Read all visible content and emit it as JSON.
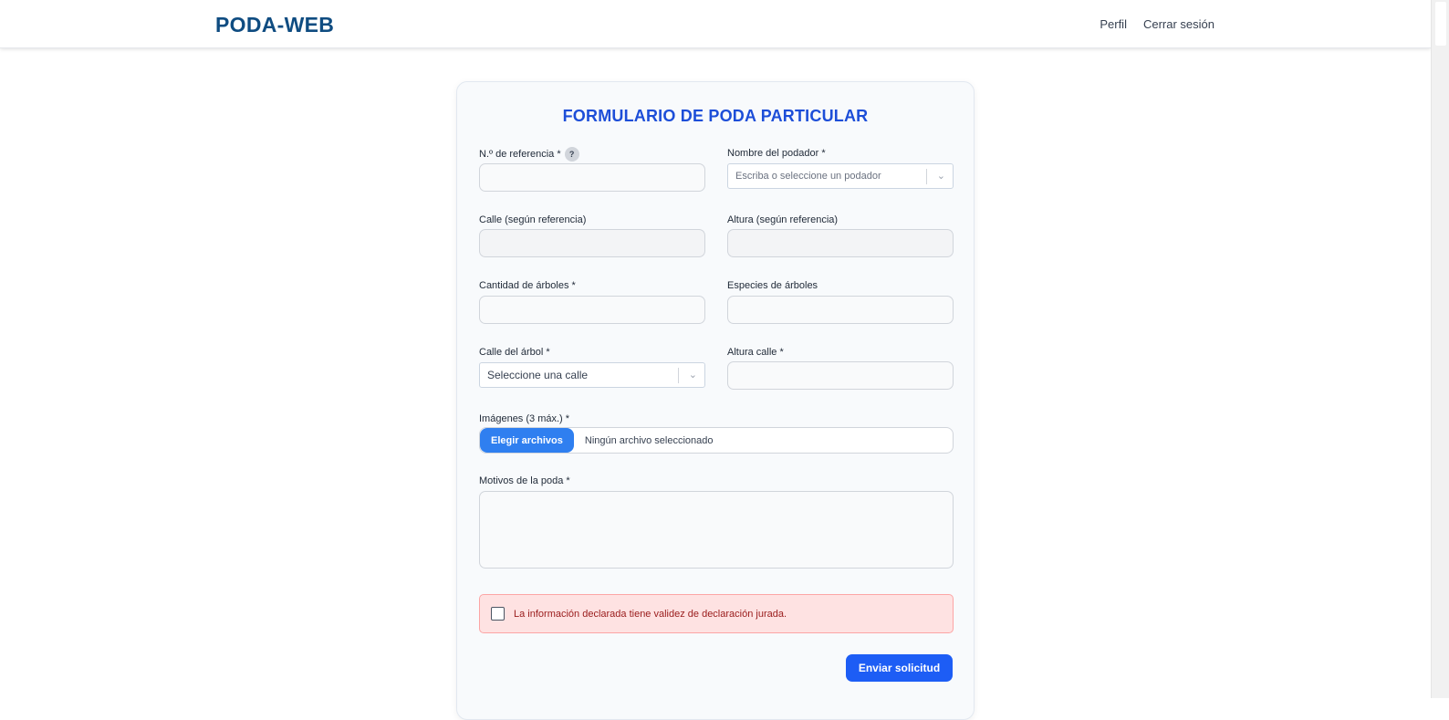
{
  "nav": {
    "brand": "PODA-WEB",
    "links": [
      "Perfil",
      "Cerrar sesión"
    ]
  },
  "form": {
    "title": "FORMULARIO DE PODA PARTICULAR",
    "fields": {
      "referencia": {
        "label": "N.º de referencia *",
        "help": "?"
      },
      "podador": {
        "label": "Nombre del podador *",
        "placeholder": "Escriba o seleccione un podador"
      },
      "calle_ref": {
        "label": "Calle (según referencia)"
      },
      "altura_ref": {
        "label": "Altura (según referencia)"
      },
      "cantidad": {
        "label": "Cantidad de árboles *"
      },
      "especies": {
        "label": "Especies de árboles"
      },
      "calle_arbol": {
        "label": "Calle del árbol *",
        "placeholder": "Seleccione una calle"
      },
      "altura_calle": {
        "label": "Altura calle *"
      },
      "imagenes": {
        "label": "Imágenes (3 máx.) *",
        "button": "Elegir archivos",
        "status": "Ningún archivo seleccionado"
      },
      "motivos": {
        "label": "Motivos de la poda *"
      }
    },
    "declaration": "La información declarada tiene validez de declaración jurada.",
    "submit": "Enviar solicitud"
  },
  "colors": {
    "brand": "#0f4c81",
    "title": "#1d4ed8",
    "primary_button": "#1d5df5",
    "file_button": "#2f7ff0",
    "alert_bg": "#fee2e2",
    "alert_text": "#991b1b"
  }
}
